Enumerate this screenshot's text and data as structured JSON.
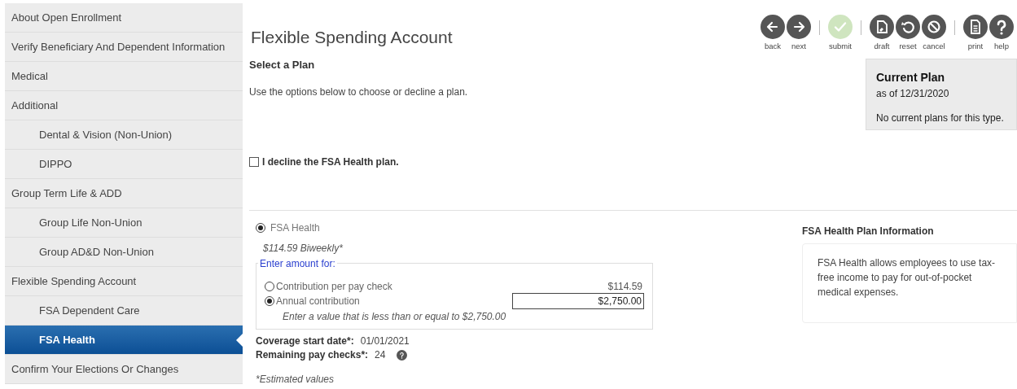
{
  "sidebar": {
    "items": [
      {
        "label": "About Open Enrollment",
        "selected": false
      },
      {
        "label": "Verify Beneficiary And Dependent Information",
        "selected": false
      },
      {
        "label": "Medical",
        "selected": false
      },
      {
        "label": "Additional",
        "selected": false,
        "children": [
          {
            "label": "Dental & Vision (Non-Union)",
            "selected": false
          },
          {
            "label": "DIPPO",
            "selected": false
          }
        ]
      },
      {
        "label": "Group Term Life & ADD",
        "selected": false,
        "children": [
          {
            "label": "Group Life Non-Union",
            "selected": false
          },
          {
            "label": "Group AD&D Non-Union",
            "selected": false
          }
        ]
      },
      {
        "label": "Flexible Spending Account",
        "selected": false,
        "children": [
          {
            "label": "FSA Dependent Care",
            "selected": false
          },
          {
            "label": "FSA Health",
            "selected": true
          }
        ]
      },
      {
        "label": "Confirm Your Elections Or Changes",
        "selected": false
      }
    ]
  },
  "page_title": "Flexible Spending Account",
  "toolbar": [
    [
      {
        "kind": "back",
        "label": "back",
        "disabled": false
      },
      {
        "kind": "next",
        "label": "next",
        "disabled": false
      }
    ],
    [
      {
        "kind": "submit",
        "label": "submit",
        "disabled": true
      }
    ],
    [
      {
        "kind": "draft",
        "label": "draft",
        "disabled": false
      },
      {
        "kind": "reset",
        "label": "reset",
        "disabled": false
      },
      {
        "kind": "cancel",
        "label": "cancel",
        "disabled": false
      }
    ],
    [
      {
        "kind": "print",
        "label": "print",
        "disabled": false
      },
      {
        "kind": "help",
        "label": "help",
        "disabled": false
      }
    ]
  ],
  "select_plan": {
    "heading": "Select a Plan",
    "description": "Use the options below to choose or decline a plan.",
    "decline": {
      "label": "I decline the FSA Health plan.",
      "checked": false
    }
  },
  "current_plan": {
    "title": "Current Plan",
    "as_of": "as of 12/31/2020",
    "message": "No current plans for this type."
  },
  "plan": {
    "label": "FSA Health",
    "selected": true,
    "cost": "$114.59 Biweekly*",
    "amount": {
      "legend": "Enter amount for:",
      "options": [
        {
          "kind": "display",
          "label": "Contribution per pay check",
          "value": "$114.59",
          "selected": false
        },
        {
          "kind": "input",
          "label": "Annual contribution",
          "value": "$2,750.00",
          "selected": true
        }
      ],
      "hint": "Enter a value that is less than or equal to $2,750.00"
    },
    "details": [
      {
        "label": "Coverage start date*:",
        "value": "01/01/2021",
        "help": false
      },
      {
        "label": "Remaining pay checks*:",
        "value": "24",
        "help": true
      }
    ],
    "note": "*Estimated values"
  },
  "plan_info": {
    "title": "FSA Health Plan Information",
    "text": "FSA Health allows employees to use tax-free income to pay for out-of-pocket medical expenses."
  }
}
